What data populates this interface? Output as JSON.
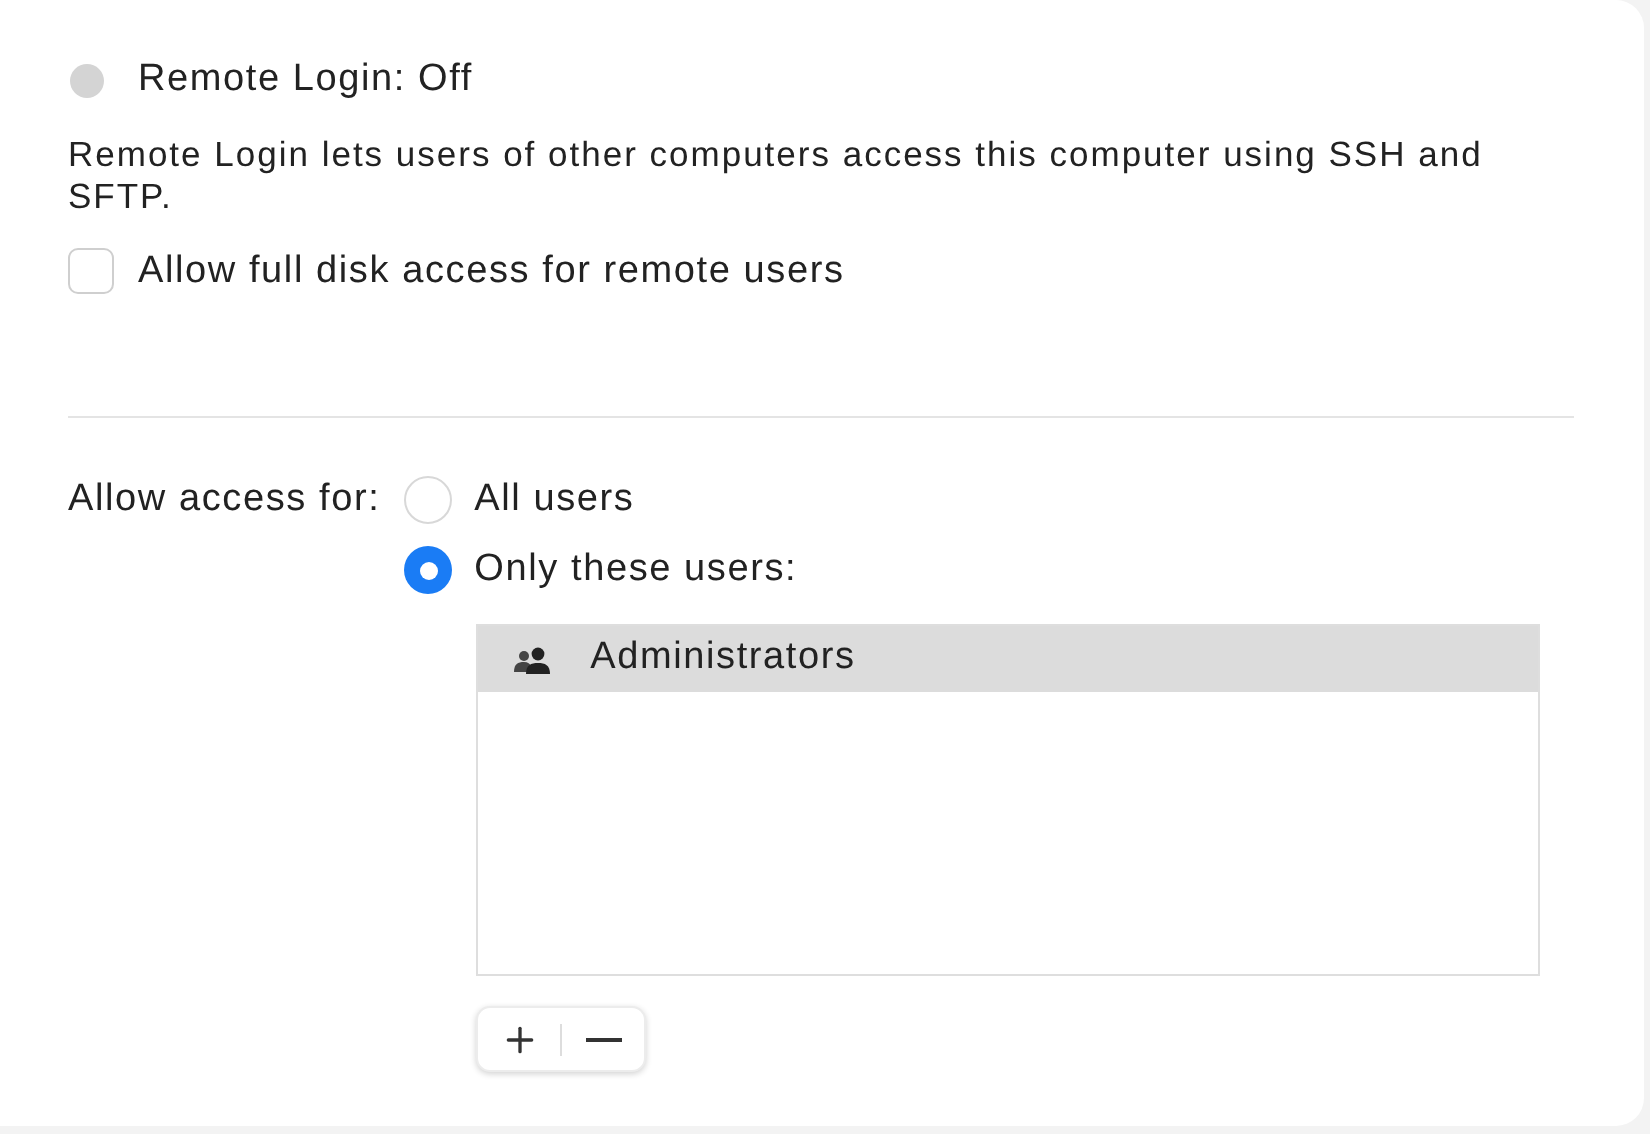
{
  "status": {
    "label": "Remote Login: Off",
    "on": false
  },
  "description": "Remote Login lets users of other computers access this computer using SSH and SFTP.",
  "full_disk": {
    "label": "Allow full disk access for remote users",
    "checked": false
  },
  "access": {
    "label": "Allow access for:",
    "options": [
      {
        "label": "All users",
        "selected": false
      },
      {
        "label": "Only these users:",
        "selected": true
      }
    ]
  },
  "users": [
    {
      "name": "Administrators",
      "selected": true
    }
  ]
}
